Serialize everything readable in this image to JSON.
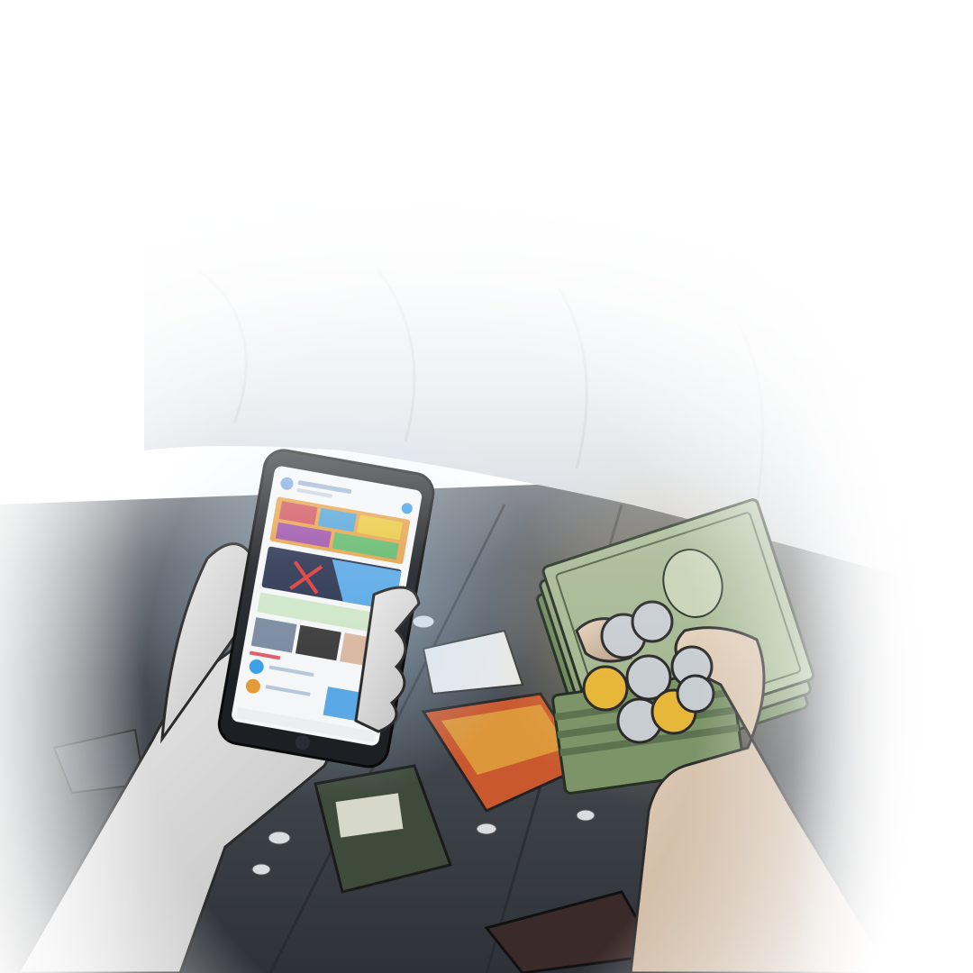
{
  "scene": {
    "background_color": "#ffffff",
    "floor_color": "#3a3f46",
    "sheet_color": "#dfe4ea",
    "phone_screen_color": "#f4f6f8",
    "phone_accent_color": "#3aa0e8",
    "bill_color": "#8fa37c",
    "gold_coin_color": "#e7b73a",
    "silver_coin_color": "#c8cdd2",
    "skin_color": "#dcdcdc"
  },
  "icons": {
    "phone": "smartphone-icon",
    "money": "cash-stack-icon",
    "coins": "coin-icon"
  }
}
